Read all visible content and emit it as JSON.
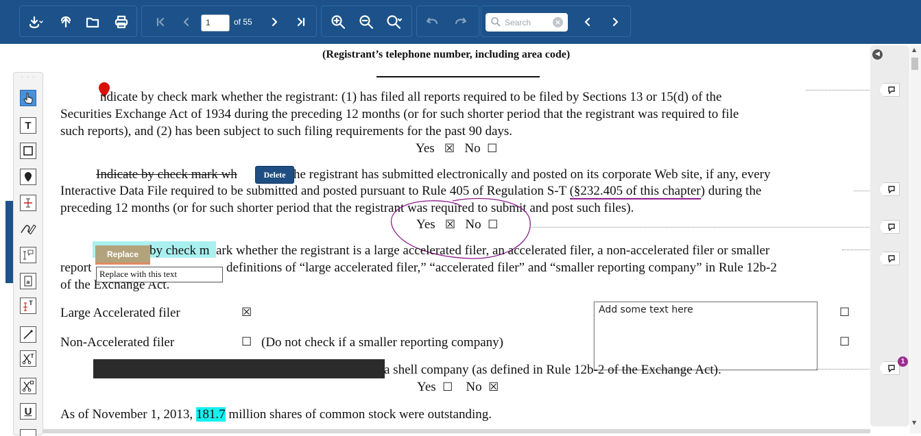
{
  "toolbar": {
    "page_current": "1",
    "page_of": "of 55",
    "search_placeholder": "Search",
    "search_clear": "×"
  },
  "left_tools": [
    "select-hand-icon",
    "text-tool-icon",
    "rectangle-tool-icon",
    "pin-tool-icon",
    "strikeout-tool-icon",
    "freehand-tool-icon",
    "text-comment-icon",
    "stamp-tool-icon",
    "insert-text-icon",
    "line-tool-icon",
    "cut-text-icon",
    "cut-image-icon",
    "underline-tool-icon"
  ],
  "left_tool_labels": {
    "text": "T",
    "underline": "U"
  },
  "document": {
    "phone_caption": "(Registrant’s telephone number, including area code)",
    "p1_line1": "ndicate by check mark whether the registrant: (1) has filed all reports required to be filed by Sections 13 or 15(d) of the",
    "p1_line2": "Securities Exchange Act of 1934 during the preceding 12 months (or for such shorter period that the registrant was required to file",
    "p1_line3": "such reports), and (2) has been subject to such filing requirements for the past 90 days.",
    "yes_label": "Yes",
    "no_label": "No",
    "checked_box": "☒",
    "empty_box": "☐",
    "p2_struck": "Indicate by check mark wh",
    "p2_line1_rest": "he registrant has submitted electronically and posted on its corporate Web site, if any, every",
    "p2_line2_a": "Interactive Data File required to be submitted and posted pursuant to Rule 405 of Regulation S-T ",
    "p2_line2_link": "(§232.405 of this chapter",
    "p2_line2_b": ") during the",
    "p2_line3": "preceding 12 months (or for such shorter period that the registrant was required to submit and post such files).",
    "p3_hl": "by check m",
    "p3_line1_rest": "ark whether the registrant is a large accelerated filer, an accelerated filer, a non-accelerated filer or smaller",
    "p3_line2_a": "report",
    "p3_line2_b": "definitions of “large accelerated filer,” “accelerated filer” and “smaller reporting company” in Rule 12b-2",
    "p3_line3": "of the Exchange Act.",
    "large_filer": "Large Accelerated filer",
    "non_filer": "Non-Accelerated filer",
    "non_filer_note": "(Do not check if a smaller reporting company)",
    "shell_text": "a shell company (as defined in Rule 12b-2 of the Exchange Act).",
    "shares_a": "As of November 1, 2013, ",
    "shares_hl": "181.7",
    "shares_b": " million shares of common stock were outstanding."
  },
  "annotations": {
    "delete_label": "Delete",
    "replace_label": "Replace",
    "replace_tip": "Replace with this text",
    "note_text": "Add some text here",
    "comment_badge": "1"
  },
  "colors": {
    "toolbar": "#1c5289",
    "ink_annotation": "#8b1a8b",
    "highlight": "#16f0f0"
  }
}
